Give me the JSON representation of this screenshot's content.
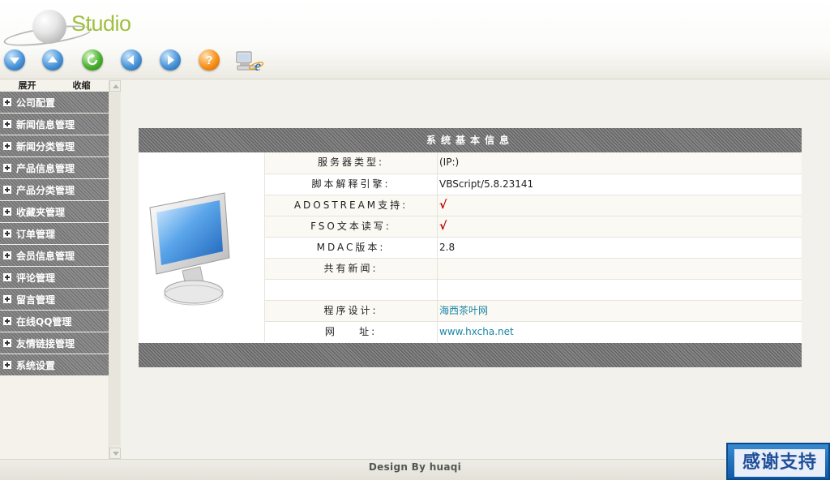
{
  "brand": {
    "logo_text": "Studio"
  },
  "toolbar": {
    "buttons": [
      {
        "name": "down-arrow-icon",
        "color": "#2f7fcf"
      },
      {
        "name": "up-arrow-icon",
        "color": "#2f7fcf"
      },
      {
        "name": "refresh-icon",
        "color": "#3aa12a"
      },
      {
        "name": "back-arrow-icon",
        "color": "#2f7fcf"
      },
      {
        "name": "forward-arrow-icon",
        "color": "#2f7fcf"
      },
      {
        "name": "help-icon",
        "color": "#f08a14"
      },
      {
        "name": "internet-explorer-icon",
        "color": "#2a6fc9"
      }
    ]
  },
  "sidebar": {
    "expand_label": "展开",
    "collapse_label": "收缩",
    "items": [
      {
        "label": "公司配置"
      },
      {
        "label": "新闻信息管理"
      },
      {
        "label": "新闻分类管理"
      },
      {
        "label": "产品信息管理"
      },
      {
        "label": "产品分类管理"
      },
      {
        "label": "收藏夹管理"
      },
      {
        "label": "订单管理"
      },
      {
        "label": "会员信息管理"
      },
      {
        "label": "评论管理"
      },
      {
        "label": "留言管理"
      },
      {
        "label": "在线QQ管理"
      },
      {
        "label": "友情链接管理"
      },
      {
        "label": "系统设置"
      }
    ]
  },
  "panel": {
    "title": "系统基本信息",
    "rows": [
      {
        "label": "服务器类型:",
        "value": "(IP:)"
      },
      {
        "label": "脚本解释引擎:",
        "value": "VBScript/5.8.23141"
      },
      {
        "label": "ADOSTREAM支持:",
        "value": "√"
      },
      {
        "label": "FSO文本读写:",
        "value": "√"
      },
      {
        "label": "MDAC版本:",
        "value": "2.8"
      },
      {
        "label": "共有新闻:",
        "value": ""
      },
      {
        "label": "",
        "value": ""
      },
      {
        "label": "程序设计:",
        "value": "海西茶叶网"
      },
      {
        "label": "网    址:",
        "value": "www.hxcha.net"
      }
    ]
  },
  "footer": {
    "credit": "Design By huaqi",
    "thanks_badge": "感谢支持"
  },
  "colors": {
    "accent_check": "#b30000",
    "link": "#1a85a6",
    "logo": "#9fbf3f"
  }
}
